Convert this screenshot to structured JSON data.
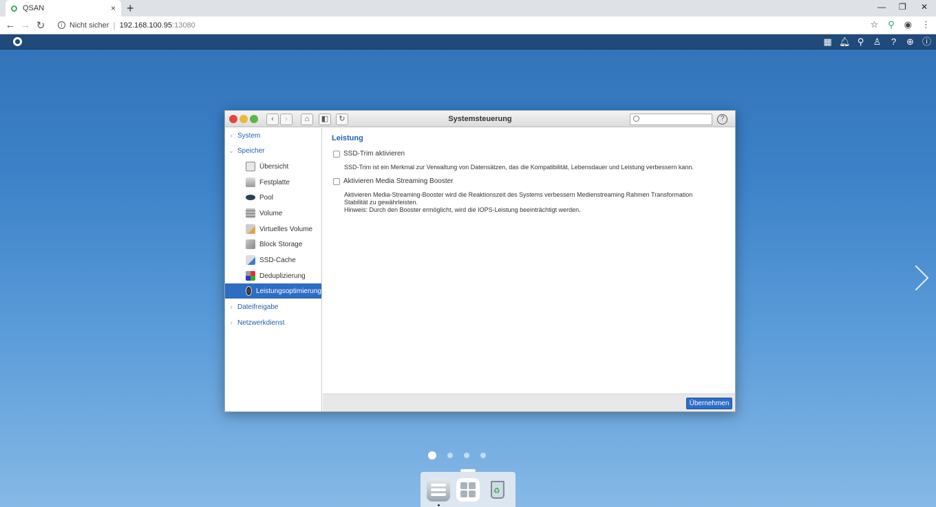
{
  "browser": {
    "tab_title": "QSAN",
    "tab_close": "×",
    "new_tab": "+",
    "security_label": "Nicht sicher",
    "url_host": "192.168.100.95",
    "url_port": ":13080",
    "minimize": "—",
    "restore": "❐",
    "close": "✕"
  },
  "window": {
    "title": "Systemsteuerung",
    "search_placeholder": "",
    "help": "?"
  },
  "sidebar": {
    "groups": [
      {
        "label": "System"
      },
      {
        "label": "Speicher"
      },
      {
        "label": "Dateifreigabe"
      },
      {
        "label": "Netzwerkdienst"
      }
    ],
    "items": [
      {
        "label": "Übersicht",
        "icon": "overview-icon"
      },
      {
        "label": "Festplatte",
        "icon": "disk-icon"
      },
      {
        "label": "Pool",
        "icon": "pool-icon"
      },
      {
        "label": "Volume",
        "icon": "volume-icon"
      },
      {
        "label": "Virtuelles Volume",
        "icon": "virtual-volume-icon"
      },
      {
        "label": "Block Storage",
        "icon": "block-storage-icon"
      },
      {
        "label": "SSD-Cache",
        "icon": "ssd-cache-icon"
      },
      {
        "label": "Deduplizierung",
        "icon": "dedup-icon"
      },
      {
        "label": "Leistungsoptimierung",
        "icon": "performance-icon"
      }
    ],
    "active_item": "Leistungsoptimierung"
  },
  "content": {
    "title": "Leistung",
    "options": [
      {
        "label": "SSD-Trim aktivieren",
        "checked": false,
        "description": [
          "SSD-Trim ist ein Merkmal zur Verwaltung von Datensätzen, das die Kompatibilität, Lebensdauer und Leistung verbessern kann."
        ]
      },
      {
        "label": "Aktivieren Media Streaming Booster",
        "checked": false,
        "description": [
          "Aktivieren Media-Streaming-Booster wird die Reaktionszeit des Systems verbessern Medienstreaming Rahmen Transformation Stabilität zu gewährleisten.",
          "Hinweis: Durch den Booster ermöglicht, wird die IOPS-Leistung beeinträchtigt werden."
        ]
      }
    ],
    "apply_label": "Übernehmen"
  },
  "pagination": {
    "pages": 4,
    "current": 1
  },
  "dock": {
    "apps": [
      "control-panel-icon",
      "app-center-icon",
      "recycle-bin-icon"
    ]
  },
  "colors": {
    "accent": "#2d6dc4",
    "link": "#1e5fb3",
    "appbar": "#1f4a7a"
  }
}
